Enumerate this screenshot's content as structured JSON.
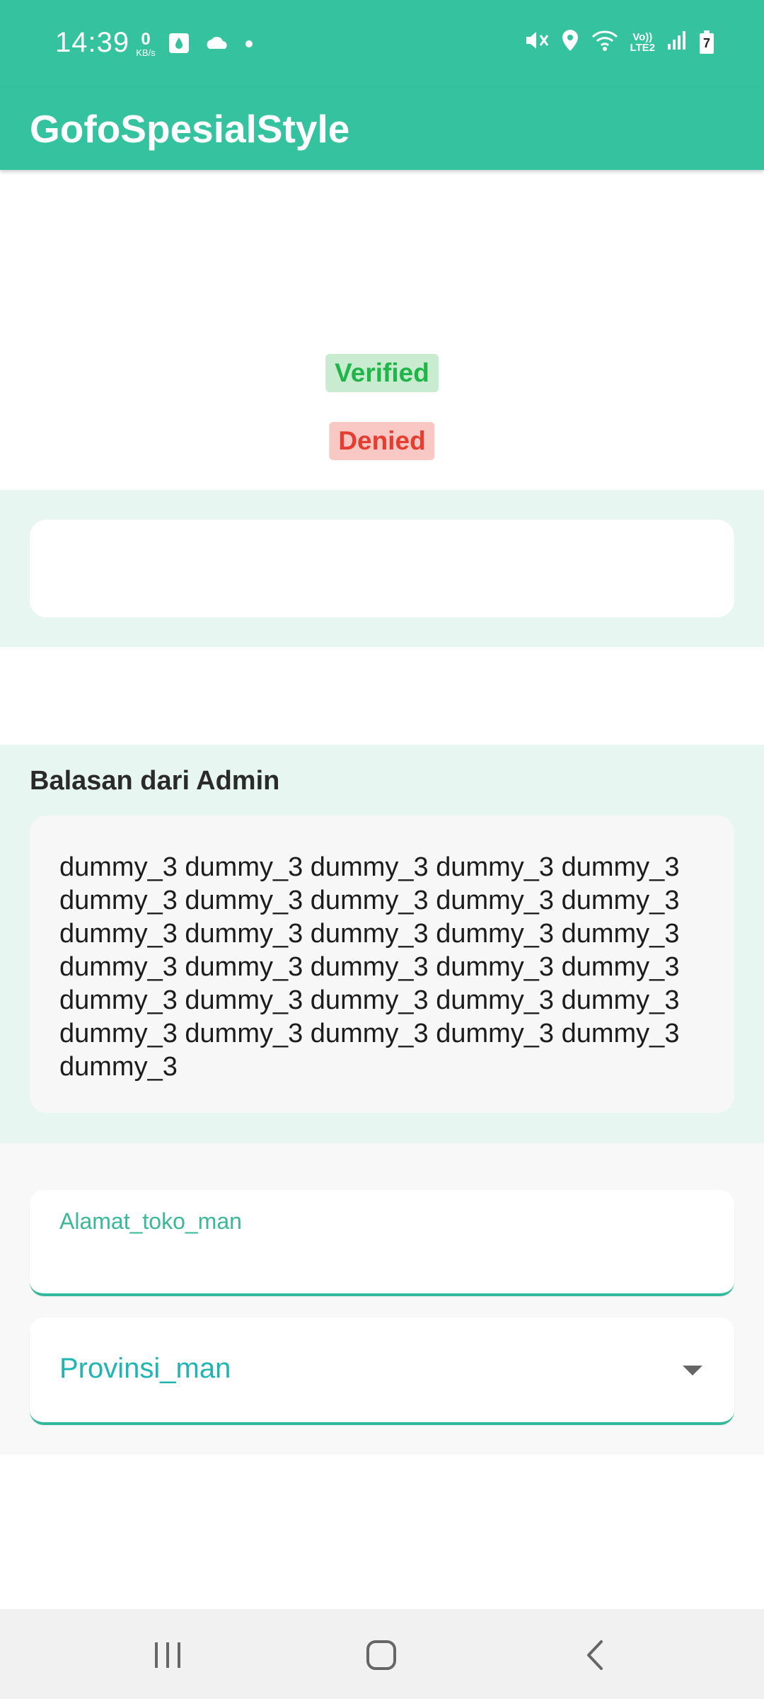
{
  "status_bar": {
    "time": "14:39",
    "net_speed_value": "0",
    "net_speed_unit": "KB/s",
    "lte_top": "Vo))",
    "lte_bottom": "LTE2",
    "battery_level": "7",
    "icons": [
      "app-notification-icon",
      "cloud-icon",
      "dot-icon",
      "mute-icon",
      "location-icon",
      "wifi-icon",
      "signal-icon",
      "battery-icon"
    ]
  },
  "app_bar": {
    "title": "GofoSpesialStyle"
  },
  "badges": {
    "verified": "Verified",
    "denied": "Denied"
  },
  "admin_reply": {
    "heading": "Balasan dari Admin",
    "text": "dummy_3 dummy_3 dummy_3 dummy_3 dummy_3 dummy_3 dummy_3 dummy_3 dummy_3 dummy_3 dummy_3 dummy_3 dummy_3 dummy_3 dummy_3 dummy_3 dummy_3 dummy_3 dummy_3 dummy_3 dummy_3 dummy_3 dummy_3 dummy_3 dummy_3 dummy_3 dummy_3 dummy_3 dummy_3 dummy_3 dummy_3"
  },
  "form": {
    "address_label": "Alamat_toko_man",
    "province_value": "Provinsi_man"
  },
  "colors": {
    "primary": "#34c29f",
    "mint_background": "#e8f6f1",
    "verified_text": "#1fb548",
    "denied_text": "#e53d2f"
  }
}
